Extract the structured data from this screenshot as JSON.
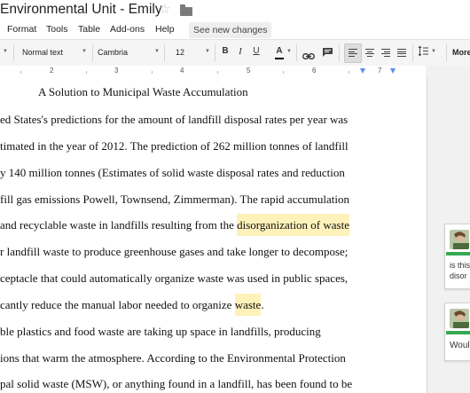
{
  "title": "Environmental Unit - Emily",
  "menu": {
    "items": [
      "Format",
      "Tools",
      "Table",
      "Add-ons",
      "Help"
    ],
    "save_status": "See new changes"
  },
  "toolbar": {
    "style": "Normal text",
    "font": "Cambria",
    "size": "12",
    "bold": "B",
    "italic": "I",
    "underline": "U",
    "text_color": "A",
    "more": "More"
  },
  "ruler": {
    "numbers": [
      "2",
      "3",
      "4",
      "5",
      "6",
      "7"
    ]
  },
  "document": {
    "heading": "A Solution to Municipal Waste Accumulation",
    "lines": [
      {
        "text": "ed States's predictions for the amount of landfill disposal rates per year was"
      },
      {
        "text": "timated in the year of 2012. The prediction of 262 million tonnes of landfill"
      },
      {
        "text": "y 140 million tonnes (Estimates of solid waste disposal rates and reduction"
      },
      {
        "text": "fill gas emissions Powell, Townsend, Zimmerman). The rapid accumulation"
      },
      {
        "text": " and recyclable waste in landfills resulting from the ",
        "highlight": "disorganization of waste"
      },
      {
        "text": "r landfill waste to produce greenhouse gases and take longer to decompose;"
      },
      {
        "text": "ceptacle that could automatically organize waste was used in public spaces,"
      },
      {
        "text": "cantly reduce the manual labor needed to organize ",
        "highlight": "waste",
        "after": "."
      },
      {
        "text": "ble plastics and food waste are taking up space in landfills, producing"
      },
      {
        "text": "ions that warm the atmosphere. According to the Environmental Protection"
      },
      {
        "text": "pal solid waste (MSW), or anything found in a landfill, has been found to be"
      }
    ]
  },
  "comments": [
    {
      "lines": [
        "is this",
        "disor"
      ]
    },
    {
      "lines": [
        "Woul"
      ]
    }
  ],
  "colors": {
    "highlight": "#fef2ba",
    "comment_accent": "#37a852",
    "ruler_marker": "#5a8dee"
  }
}
